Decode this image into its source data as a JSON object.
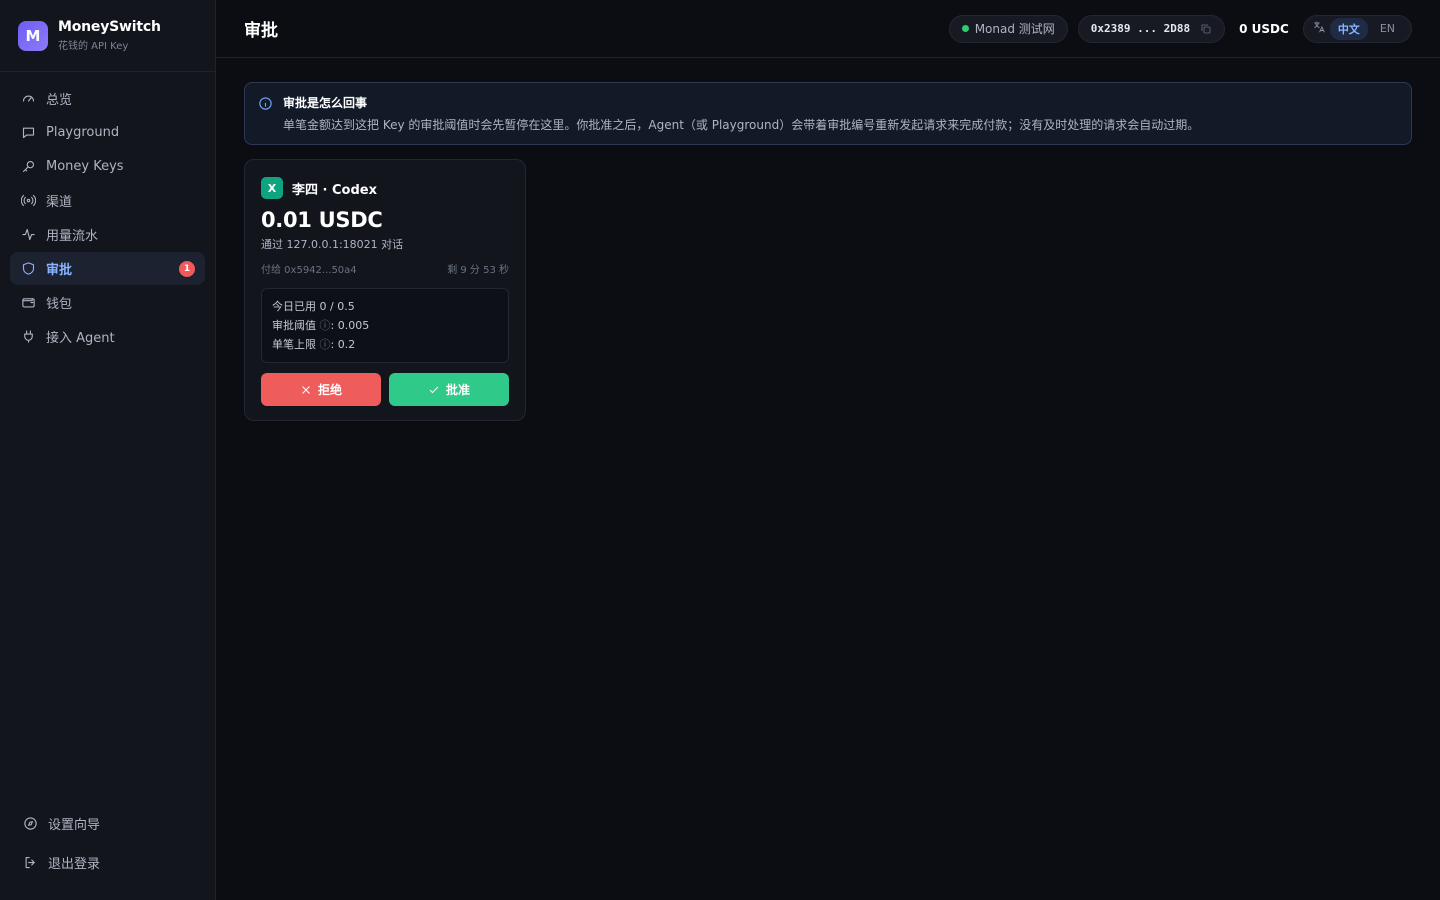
{
  "brand": {
    "logo_letter": "M",
    "name": "MoneySwitch",
    "subtitle": "花钱的 API Key"
  },
  "sidebar": {
    "items": [
      {
        "label": "总览",
        "icon": "gauge-icon"
      },
      {
        "label": "Playground",
        "icon": "chat-icon"
      },
      {
        "label": "Money Keys",
        "icon": "key-icon"
      },
      {
        "label": "渠道",
        "icon": "broadcast-icon"
      },
      {
        "label": "用量流水",
        "icon": "activity-icon"
      },
      {
        "label": "审批",
        "icon": "shield-icon",
        "active": true,
        "badge": "1"
      },
      {
        "label": "钱包",
        "icon": "wallet-icon"
      },
      {
        "label": "接入 Agent",
        "icon": "plug-icon"
      }
    ],
    "bottom": [
      {
        "label": "设置向导",
        "icon": "compass-icon"
      },
      {
        "label": "退出登录",
        "icon": "logout-icon"
      }
    ]
  },
  "header": {
    "title": "审批",
    "network": "Monad 测试网",
    "address": "0x2389 ... 2D88",
    "balance": "0 USDC",
    "lang_zh": "中文",
    "lang_en": "EN"
  },
  "info": {
    "title": "审批是怎么回事",
    "text": "单笔金额达到这把 Key 的审批阈值时会先暂停在这里。你批准之后，Agent（或 Playground）会带着审批编号重新发起请求来完成付款；没有及时处理的请求会自动过期。"
  },
  "request": {
    "avatar_letter": "X",
    "agent": "李四 · Codex",
    "amount": "0.01 USDC",
    "via": "通过 127.0.0.1:18021 对话",
    "pay_to": "付给 0x5942...50a4",
    "remaining": "剩 9 分 53 秒",
    "used_label": "今日已用 0 / 0.5",
    "threshold_label": "审批阈值",
    "threshold_value": ": 0.005",
    "cap_label": "单笔上限",
    "cap_value": ": 0.2",
    "reject": "拒绝",
    "approve": "批准"
  },
  "colors": {
    "accent": "#8ab4ff",
    "reject": "#ef5c5c",
    "approve": "#2fc98a",
    "badge": "#f05a5a",
    "brand": "#6d5cf6"
  }
}
